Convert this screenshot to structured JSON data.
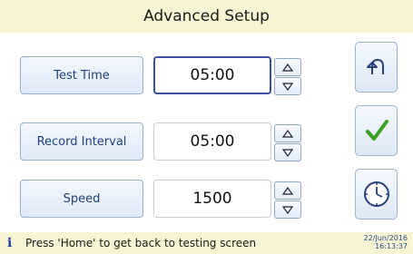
{
  "header": {
    "title": "Advanced Setup"
  },
  "rows": [
    {
      "label": "Test Time",
      "value": "05:00"
    },
    {
      "label": "Record Interval",
      "value": "05:00"
    },
    {
      "label": "Speed",
      "value": "1500"
    }
  ],
  "side_buttons": {
    "back_icon": "undo-arrow-icon",
    "confirm_icon": "checkmark-icon",
    "clock_icon": "clock-icon"
  },
  "status": {
    "info_icon": "i",
    "message": "Press 'Home' to get back to testing screen",
    "date": "22/Jun/2016",
    "time": "16:13:37"
  },
  "colors": {
    "background": "#f6f4d2",
    "accent": "#1f3f7a",
    "check": "#3aa020"
  }
}
